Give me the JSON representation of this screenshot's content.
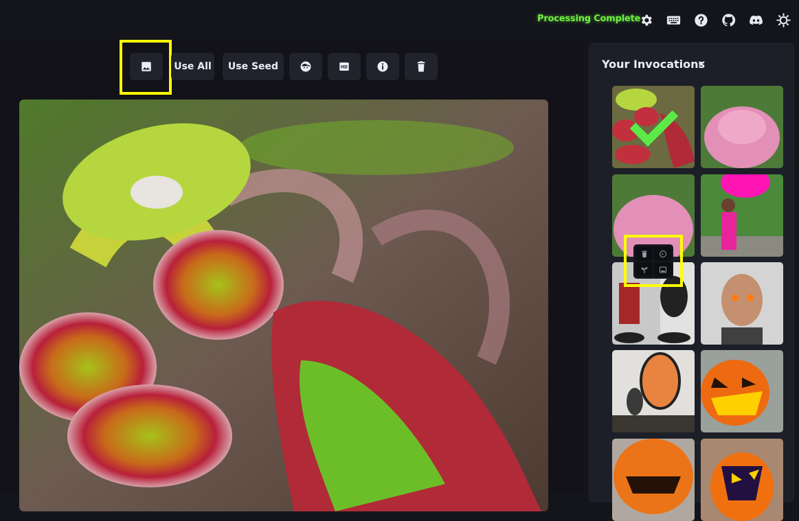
{
  "header": {
    "status_text": "Processing Complete",
    "status_color": "#6ef03f",
    "icons": [
      "gear-icon",
      "keyboard-icon",
      "help-icon",
      "github-icon",
      "discord-icon",
      "theme-toggle-icon"
    ]
  },
  "toolbar": {
    "send_to_img2img_icon": "image-icon",
    "use_all_label": "Use All",
    "use_seed_label": "Use Seed",
    "face_restore_icon": "face-icon",
    "upscale_icon": "hd-icon",
    "info_icon": "info-icon",
    "delete_icon": "trash-icon"
  },
  "main_image": {
    "subject": "Pitcher plants close-up (red and green carnivorous plant)"
  },
  "gallery": {
    "title": "Your Invocations",
    "close_glyph": "×",
    "items": [
      {
        "subject": "pitcher plants",
        "selected": true
      },
      {
        "subject": "pink flower bush"
      },
      {
        "subject": "pink flower bush"
      },
      {
        "subject": "girl with pink balloon"
      },
      {
        "subject": "figurines with crow"
      },
      {
        "subject": "man with glowing eyes"
      },
      {
        "subject": "carved mask sculpture"
      },
      {
        "subject": "jack-o-lantern"
      },
      {
        "subject": "jack-o-lantern"
      },
      {
        "subject": "jack-o-lantern"
      }
    ],
    "hover_tools": [
      "trash-icon",
      "use-all-icon",
      "seed-icon",
      "image-icon"
    ]
  },
  "accent_highlight_color": "#ffff00"
}
